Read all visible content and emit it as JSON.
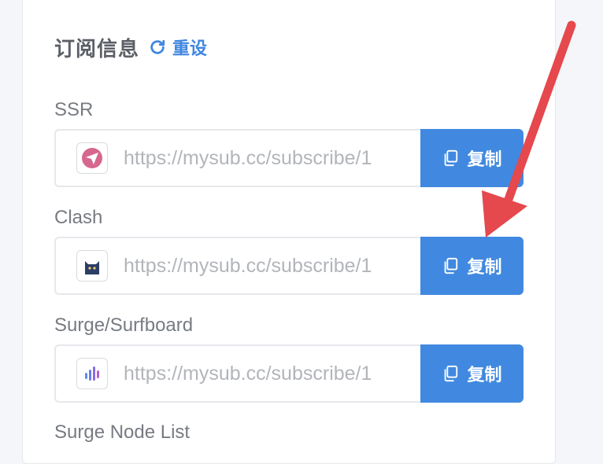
{
  "header": {
    "title": "订阅信息",
    "reset_label": "重设",
    "accent_color": "#4189e0"
  },
  "subscriptions": [
    {
      "label": "SSR",
      "url": "https://mysub.cc/subscribe/1",
      "icon": "paper-plane-icon",
      "copy_label": "复制"
    },
    {
      "label": "Clash",
      "url": "https://mysub.cc/subscribe/1",
      "icon": "cat-icon",
      "copy_label": "复制"
    },
    {
      "label": "Surge/Surfboard",
      "url": "https://mysub.cc/subscribe/1",
      "icon": "waveform-icon",
      "copy_label": "复制"
    },
    {
      "label": "Surge Node List"
    }
  ],
  "annotation": {
    "arrow_color": "#e5484d",
    "points_to": "copy-button-clash"
  }
}
